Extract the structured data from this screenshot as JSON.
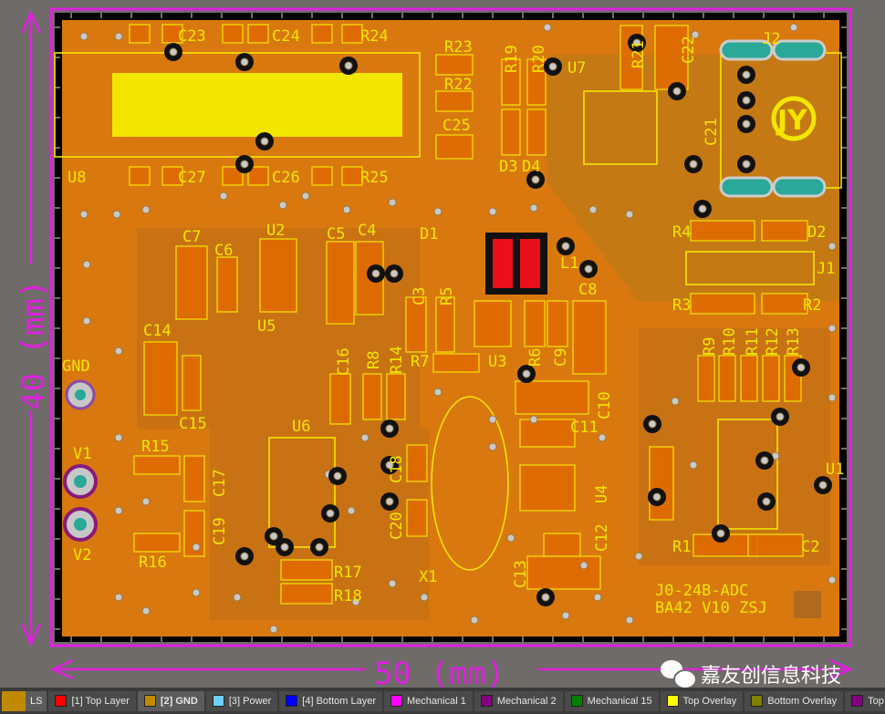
{
  "board": {
    "width_dim": "50 (mm)",
    "height_dim": "40 (mm)",
    "colors": {
      "copper": "#d8780f",
      "board_edge": "#e020e0",
      "silkscreen": "#f2e600",
      "keepout": "#000000"
    },
    "board_text": [
      "J0-24B-ADC",
      "BA42 V10 ZSJ"
    ],
    "designators": [
      "C23",
      "C24",
      "R24",
      "R23",
      "R22",
      "C25",
      "R19",
      "R20",
      "U7",
      "R21",
      "C22",
      "J2",
      "U8",
      "C27",
      "C26",
      "R25",
      "D3",
      "D4",
      "C21",
      "R4",
      "D2",
      "J1",
      "R3",
      "R2",
      "C7",
      "C6",
      "U2",
      "C5",
      "C4",
      "D1",
      "L1",
      "C3",
      "R5",
      "C8",
      "C14",
      "U5",
      "C16",
      "R8",
      "R14",
      "R7",
      "U3",
      "R6",
      "C9",
      "C10",
      "R9",
      "R10",
      "R11",
      "R12",
      "R13",
      "GND",
      "C15",
      "U6",
      "C11",
      "R15",
      "C17",
      "C18",
      "V1",
      "U4",
      "C19",
      "C20",
      "V2",
      "R16",
      "R1",
      "C2",
      "C12",
      "R17",
      "R18",
      "X1",
      "C13",
      "U1"
    ],
    "logo": "JY"
  },
  "watermark": "嘉友创信息科技",
  "layer_bar": {
    "ls_label": "LS",
    "tabs": [
      {
        "label": "[1] Top Layer",
        "color": "#ff0000"
      },
      {
        "label": "[2] GND",
        "color": "#c08a00",
        "active": true
      },
      {
        "label": "[3] Power",
        "color": "#6fd0ff"
      },
      {
        "label": "[4] Bottom Layer",
        "color": "#0000ff"
      },
      {
        "label": "Mechanical 1",
        "color": "#ff00ff"
      },
      {
        "label": "Mechanical 2",
        "color": "#800080"
      },
      {
        "label": "Mechanical 15",
        "color": "#008000"
      },
      {
        "label": "Top Overlay",
        "color": "#ffff00"
      },
      {
        "label": "Bottom Overlay",
        "color": "#808000"
      },
      {
        "label": "Top Solder",
        "color": "#800080"
      }
    ]
  }
}
